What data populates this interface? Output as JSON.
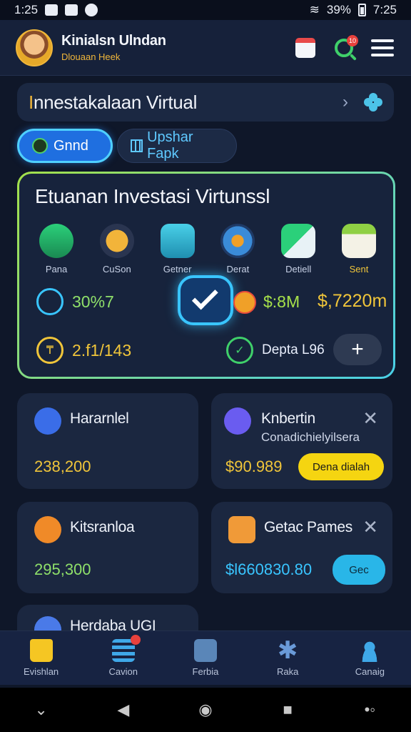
{
  "status_bar": {
    "time": "1:25",
    "battery": "39%",
    "clock_right": "7:25"
  },
  "header": {
    "user_name": "Kinialsn Ulndan",
    "user_sub": "Dlouaan Heek",
    "notif_count": "10"
  },
  "section": {
    "title": "Innestakalaan Virtual"
  },
  "tabs": [
    {
      "label": "Gnnd",
      "active": true
    },
    {
      "label": "Upshar Fapk",
      "active": false
    }
  ],
  "main_card": {
    "title": "Etuanan Investasi Virtunssl",
    "categories": [
      {
        "label": "Pana",
        "icon": "house-icon"
      },
      {
        "label": "CuSon",
        "icon": "gold-bar-icon"
      },
      {
        "label": "Getner",
        "icon": "folder-icon"
      },
      {
        "label": "Derat",
        "icon": "gear-icon"
      },
      {
        "label": "Detiell",
        "icon": "envelope-open-icon"
      },
      {
        "label": "Sent",
        "icon": "envelope-icon"
      }
    ],
    "stat_1": "30%7",
    "stat_2": "$:8M",
    "stat_3": "$,7220m",
    "stat_4": "2.f1/143",
    "stat_5": "Depta L96",
    "plus_label": "+"
  },
  "cards": [
    {
      "title": "Hararnlel",
      "value": "238,200",
      "icon": "spoon-icon"
    },
    {
      "title": "Knbertin",
      "subtitle": "Conadichielyilsera",
      "value": "$90.989",
      "button": "Dena dialah",
      "icon": "settings-icon"
    },
    {
      "title": "Kitsranloa",
      "value": "295,300",
      "icon": "coin-icon"
    },
    {
      "title": "Getac Pames",
      "value": "$l660830.80",
      "button": "Gec",
      "icon": "trophy-icon"
    },
    {
      "title": "Herdaba UGI",
      "icon": "shield-icon"
    }
  ],
  "bottom_nav": [
    {
      "label": "Evishlan",
      "icon": "home-icon"
    },
    {
      "label": "Cavion",
      "icon": "list-icon"
    },
    {
      "label": "Ferbia",
      "icon": "bag-icon"
    },
    {
      "label": "Raka",
      "icon": "star-icon"
    },
    {
      "label": "Canaig",
      "icon": "profile-icon"
    }
  ],
  "colors": {
    "accent": "#1f6fe0",
    "green": "#3fd06a",
    "yellow": "#f0c53a",
    "cyan": "#39c5ff"
  }
}
